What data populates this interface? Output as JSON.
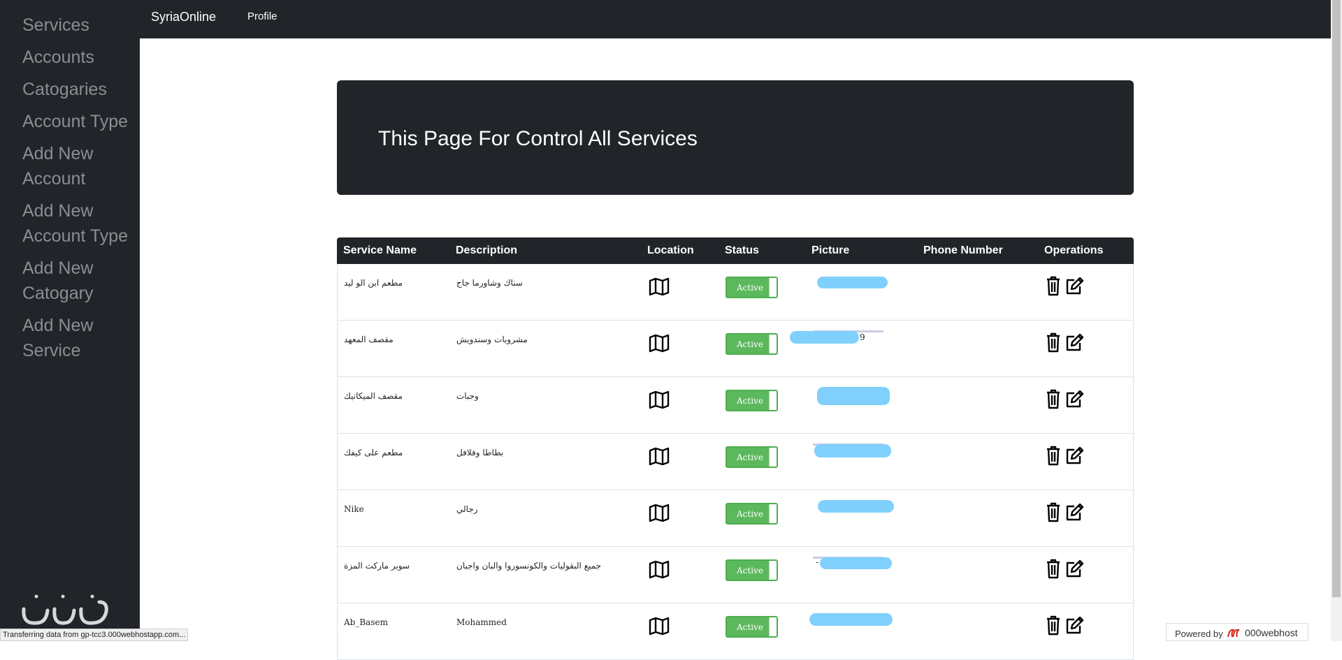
{
  "sidebar": {
    "items": [
      {
        "label": "Services"
      },
      {
        "label": "Accounts"
      },
      {
        "label": "Catogaries"
      },
      {
        "label": "Account Type"
      },
      {
        "label": "Add New Account"
      },
      {
        "label": "Add New Account Type"
      },
      {
        "label": "Add New Catogary"
      },
      {
        "label": "Add New Service"
      }
    ]
  },
  "topbar": {
    "brand": "SyriaOnline",
    "profile": "Profile"
  },
  "jumbotron": {
    "title": "This Page For Control All Services"
  },
  "table": {
    "headers": {
      "name": "Service Name",
      "description": "Description",
      "location": "Location",
      "status": "Status",
      "picture": "Picture",
      "phone": "Phone Number",
      "operations": "Operations"
    },
    "rows": [
      {
        "name": "مطعم ابن الو ليد",
        "description": "سناك وشاورما جاج",
        "status": "Active"
      },
      {
        "name": "مقصف المعهد",
        "description": "مشروبات وسندويش",
        "status": "Active",
        "phone_suffix": "9"
      },
      {
        "name": "مقصف الميكانيك",
        "description": "وجبات",
        "status": "Active"
      },
      {
        "name": "مطعم على كيفك",
        "description": "بطاطا وفلافل",
        "status": "Active"
      },
      {
        "name": "Nike",
        "description": "رجالي",
        "status": "Active"
      },
      {
        "name": "سوبر ماركت المزة",
        "description": "جميع البقوليات والكونسوروا والبان واجبان",
        "status": "Active",
        "phone_prefix": "-"
      },
      {
        "name": "Ab_Basem",
        "description": "Mohammed",
        "status": "Active"
      }
    ]
  },
  "statusbar": {
    "text": "Transferring data from gp-tcc3.000webhostapp.com..."
  },
  "powered": {
    "label": "Powered by",
    "host": "000webhost"
  },
  "colors": {
    "dark": "#212529",
    "sidebar_text": "#8a8e93",
    "active_green": "#5cb85c",
    "phone_redaction": "#7fd0fc"
  }
}
